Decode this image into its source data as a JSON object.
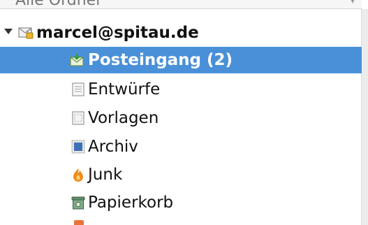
{
  "header": {
    "column_label": "Alle Ordner"
  },
  "account": {
    "name": "marcel@spitau.de"
  },
  "folders": [
    {
      "label": "Posteingang (2)",
      "icon": "inbox-icon",
      "selected": true
    },
    {
      "label": "Entwürfe",
      "icon": "drafts-icon",
      "selected": false
    },
    {
      "label": "Vorlagen",
      "icon": "templates-icon",
      "selected": false
    },
    {
      "label": "Archiv",
      "icon": "archive-icon",
      "selected": false
    },
    {
      "label": "Junk",
      "icon": "junk-icon",
      "selected": false
    },
    {
      "label": "Papierkorb",
      "icon": "trash-icon",
      "selected": false
    }
  ],
  "colors": {
    "selection": "#4a90d9",
    "text": "#111111"
  }
}
